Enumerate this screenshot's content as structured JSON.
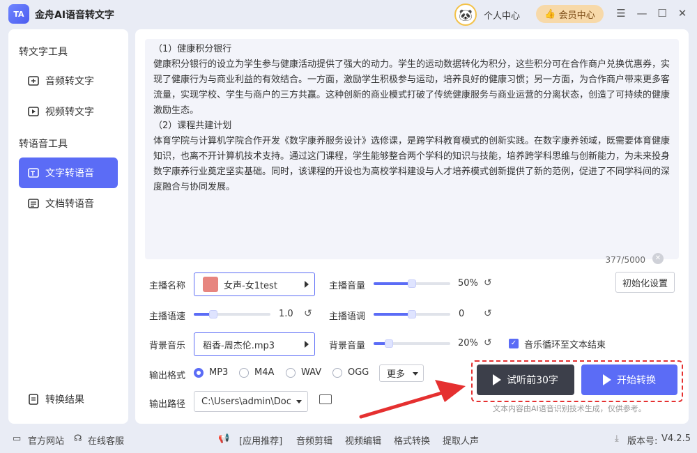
{
  "app": {
    "logo_text": "TA",
    "title": "金舟AI语音转文字"
  },
  "header": {
    "avatar_icon": "panda-icon",
    "personal_center": "个人中心",
    "vip_center": "会员中心"
  },
  "sidebar": {
    "section1": "转文字工具",
    "section2": "转语音工具",
    "items": [
      {
        "label": "音频转文字",
        "icon": "audio-to-text-icon",
        "active": false
      },
      {
        "label": "视频转文字",
        "icon": "video-to-text-icon",
        "active": false
      },
      {
        "label": "文字转语音",
        "icon": "text-to-speech-icon",
        "active": true
      },
      {
        "label": "文档转语音",
        "icon": "doc-to-speech-icon",
        "active": false
      }
    ],
    "result": "转换结果"
  },
  "editor": {
    "lines": [
      "（1）健康积分银行",
      "健康积分银行的设立为学生参与健康活动提供了强大的动力。学生的运动数据转化为积分，这些积分可在合作商户兑换优惠券，实现了健康行为与商业利益的有效结合。一方面，激励学生积极参与运动，培养良好的健康习惯；另一方面，为合作商户带来更多客流量，实现学校、学生与商户的三方共赢。这种创新的商业模式打破了传统健康服务与商业运营的分离状态，创造了可持续的健康激励生态。",
      "（2）课程共建计划",
      "体育学院与计算机学院合作开发《数字康养服务设计》选修课，是跨学科教育模式的创新实践。在数字康养领域，既需要体育健康知识，也离不开计算机技术支持。通过这门课程，学生能够整合两个学科的知识与技能，培养跨学科思维与创新能力，为未来投身数字康养行业奠定坚实基础。同时，该课程的开设也为高校学科建设与人才培养模式创新提供了新的范例，促进了不同学科间的深度融合与协同发展。"
    ],
    "count": "377/5000"
  },
  "settings": {
    "anchor_label": "主播名称",
    "anchor_value": "女声-女1test",
    "volume_label": "主播音量",
    "volume_value": "50%",
    "volume_level": 0.5,
    "speed_label": "主播语速",
    "speed_value": "1.0",
    "speed_level": 0.25,
    "pitch_label": "主播语调",
    "pitch_value": "0",
    "pitch_level": 0.5,
    "bgm_label": "背景音乐",
    "bgm_value": "稻香-周杰伦.mp3",
    "bgm_volume_label": "背景音量",
    "bgm_volume_value": "20%",
    "bgm_volume_level": 0.2,
    "loop_label": "音乐循环至文本结束",
    "loop_checked": true,
    "init_button": "初始化设置",
    "format_label": "输出格式",
    "formats": [
      "MP3",
      "M4A",
      "WAV",
      "OGG"
    ],
    "selected_format": "MP3",
    "more": "更多",
    "path_label": "输出路径",
    "path_value": "C:\\Users\\admin\\Doc"
  },
  "actions": {
    "listen": "试听前30字",
    "start": "开始转换"
  },
  "disclaimer": "文本内容由AI语音识别技术生成，仅供参考。",
  "footer": {
    "website": "官方网站",
    "service": "在线客服",
    "recommend": "[应用推荐]",
    "links": [
      "音频剪辑",
      "视频编辑",
      "格式转换",
      "提取人声"
    ],
    "version_label": "版本号:",
    "version": "V4.2.5"
  },
  "colors": {
    "accent": "#5b6cf6",
    "dark_button": "#3c3f4a",
    "highlight": "#e53030",
    "vip_bg": "#f7d9a9"
  }
}
